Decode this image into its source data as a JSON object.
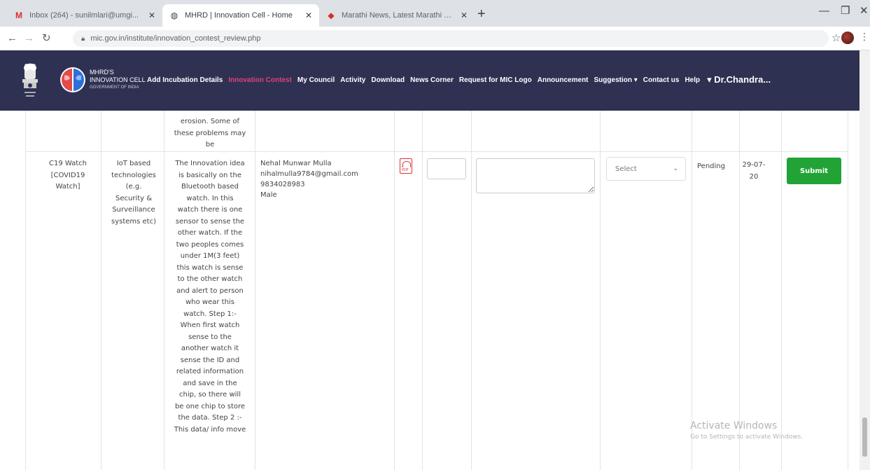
{
  "browser": {
    "tabs": [
      {
        "title": "Inbox (264) - sunilmlari@umgi...",
        "favicon": "gmail-icon",
        "active": false
      },
      {
        "title": "MHRD | Innovation Cell - Home",
        "favicon": "globe-icon",
        "active": true
      },
      {
        "title": "Marathi News, Latest Marathi N...",
        "favicon": "news-icon",
        "active": false
      }
    ],
    "url": "mic.gov.in/institute/innovation_contest_review.php"
  },
  "nav": {
    "brand_line1": "MHRD'S",
    "brand_line2": "INNOVATION CELL",
    "brand_sub": "GOVERNMENT OF INDIA",
    "items": [
      {
        "label": "Add Incubation Details",
        "highlight": false
      },
      {
        "label": "Innovation Contest",
        "highlight": true
      },
      {
        "label": "My Council",
        "highlight": false
      },
      {
        "label": "Activity",
        "highlight": false
      },
      {
        "label": "Download",
        "highlight": false
      },
      {
        "label": "News Corner",
        "highlight": false
      },
      {
        "label": "Request for MIC Logo",
        "highlight": false
      },
      {
        "label": "Announcement",
        "highlight": false
      },
      {
        "label": "Suggestion ▾",
        "highlight": false
      },
      {
        "label": "Contact us",
        "highlight": false
      },
      {
        "label": "Help",
        "highlight": false
      }
    ],
    "user": "▾ Dr.Chandra..."
  },
  "prev_row": {
    "desc_lines": [
      "erosion. Some of",
      "these problems may",
      "be"
    ]
  },
  "row": {
    "title_lines": [
      "C19 Watch",
      "[COVID19",
      "Watch]"
    ],
    "category_lines": [
      "IoT based",
      "technologies",
      "(e.g.",
      "Security &",
      "Surveillance",
      "systems etc)"
    ],
    "desc_lines": [
      "The Innovation idea",
      "is basically on the",
      "Bluetooth based",
      "watch. In this",
      "watch there is one",
      "sensor to sense the",
      "other watch. If the",
      "two peoples comes",
      "under 1M(3 feet)",
      "this watch is sense",
      "to the other watch",
      "and alert to person",
      "who wear this",
      "watch. Step 1:-",
      "When first watch",
      "sense to the",
      "another watch it",
      "sense the ID and",
      "related information",
      "and save in the",
      "chip, so there will",
      "be one chip to store",
      "the data. Step 2 :-",
      "This data/ info move"
    ],
    "contact": {
      "name": "Nehal Munwar Mulla",
      "email": "nihalmulla9784@gmail.com",
      "phone": "9834028983",
      "gender": "Male"
    },
    "marks_value": "",
    "remarks_value": "",
    "select_value": "Select",
    "status": "Pending",
    "date_lines": [
      "29-07-",
      "20"
    ],
    "submit_label": "Submit"
  },
  "watermark": {
    "line1": "Activate Windows",
    "line2": "Go to Settings to activate Windows."
  }
}
